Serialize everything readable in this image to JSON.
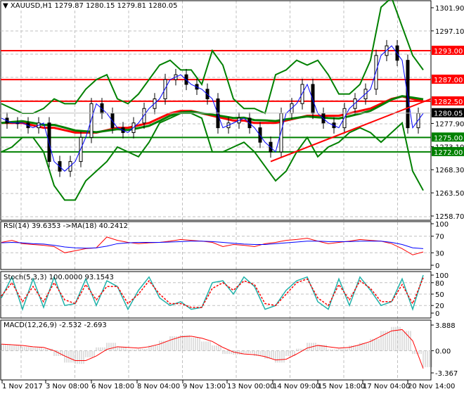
{
  "header": {
    "symbol": "XAUUSD,H1",
    "ohlc": "1279.87 1280.15 1279.81 1280.05"
  },
  "colors": {
    "up_line": "#ff0000",
    "support": "#008000",
    "bands": "#008000",
    "price": "#000000",
    "rsi": "#ff0000",
    "rsi_ma": "#0000ff",
    "stoch_k": "#20b2aa",
    "stoch_d": "#ff0000",
    "macd": "#c0c0c0",
    "signal": "#ff0000",
    "current": "#000000"
  },
  "chart_data": [
    {
      "type": "line",
      "title": "XAUUSD,H1",
      "ylim": [
        1258.7,
        1301.9
      ],
      "y_ticks": [
        "1301.90",
        "1297.10",
        "1293.00",
        "1287.00",
        "1282.50",
        "1280.05",
        "1277.90",
        "1275.00",
        "1273.10",
        "1272.00",
        "1268.30",
        "1263.50",
        "1258.70"
      ],
      "x_ticks": [
        "1 Nov 2017",
        "3 Nov 08:00",
        "6 Nov 18:00",
        "8 Nov 04:00",
        "9 Nov 13:00",
        "13 Nov 00:00",
        "14 Nov 09:00",
        "15 Nov 18:00",
        "17 Nov 04:00",
        "20 Nov 14:00"
      ],
      "resistance_levels": [
        1293.0,
        1287.0,
        1282.5
      ],
      "support_levels": [
        1275.0,
        1272.0
      ],
      "current_price": 1280.05,
      "trendline": [
        [
          1270.0,
          1283.0
        ]
      ],
      "series": [
        {
          "key": "close",
          "values": [
            1279,
            1278,
            1278,
            1277,
            1278,
            1270,
            1268,
            1270,
            1275,
            1282,
            1280,
            1277,
            1276,
            1278,
            1281,
            1283,
            1287,
            1288,
            1286,
            1285,
            1283,
            1277,
            1278,
            1279,
            1277,
            1274,
            1272,
            1280,
            1282,
            1286,
            1280,
            1278,
            1277,
            1281,
            1283,
            1285,
            1292,
            1294,
            1291,
            1277,
            1280
          ]
        },
        {
          "key": "upper_band",
          "values": [
            1282,
            1281,
            1280,
            1280,
            1281,
            1283,
            1282,
            1282,
            1285,
            1287,
            1288,
            1283,
            1282,
            1284,
            1287,
            1290,
            1291,
            1289,
            1289,
            1286,
            1293,
            1290,
            1283,
            1281,
            1281,
            1280,
            1288,
            1289,
            1291,
            1290,
            1291,
            1288,
            1284,
            1284,
            1286,
            1291,
            1302,
            1304,
            1298,
            1292,
            1289
          ]
        },
        {
          "key": "lower_band",
          "values": [
            1272,
            1273,
            1275,
            1275,
            1272,
            1265,
            1262,
            1262,
            1266,
            1268,
            1270,
            1273,
            1272,
            1271,
            1274,
            1278,
            1279,
            1280,
            1280,
            1279,
            1272,
            1272,
            1273,
            1274,
            1272,
            1269,
            1266,
            1268,
            1272,
            1275,
            1271,
            1273,
            1274,
            1276,
            1277,
            1276,
            1274,
            1276,
            1278,
            1268,
            1264
          ]
        },
        {
          "key": "slow_ma",
          "values": [
            1278,
            1278,
            1278,
            1277.5,
            1277,
            1277,
            1276.5,
            1276,
            1276,
            1276,
            1276.5,
            1277,
            1277,
            1277.5,
            1278,
            1279,
            1280,
            1280.5,
            1280.5,
            1280,
            1279.5,
            1279,
            1278.5,
            1278.5,
            1278,
            1278,
            1278,
            1278.5,
            1279,
            1279.5,
            1279.5,
            1279.5,
            1279.5,
            1280,
            1280.5,
            1281,
            1282,
            1283,
            1283.5,
            1283,
            1282.5
          ]
        }
      ]
    },
    {
      "type": "line",
      "title": "RSI(14) 39.6353  ->MA(18) 40.2412",
      "ylim": [
        0,
        100
      ],
      "y_ticks": [
        "100",
        "70",
        "30",
        "0"
      ],
      "series": [
        {
          "key": "rsi",
          "values": [
            55,
            60,
            52,
            50,
            48,
            45,
            30,
            35,
            40,
            42,
            68,
            60,
            55,
            52,
            54,
            55,
            58,
            62,
            60,
            58,
            55,
            45,
            50,
            48,
            45,
            52,
            55,
            60,
            62,
            65,
            58,
            52,
            55,
            58,
            62,
            60,
            58,
            52,
            40,
            25,
            32
          ]
        },
        {
          "key": "rsi_ma",
          "values": [
            54,
            55,
            54,
            52,
            51,
            48,
            44,
            42,
            41,
            42,
            46,
            52,
            54,
            55,
            55,
            55,
            56,
            57,
            58,
            58,
            57,
            55,
            53,
            51,
            50,
            50,
            52,
            54,
            56,
            58,
            58,
            57,
            57,
            57,
            58,
            58,
            58,
            55,
            50,
            42,
            40
          ]
        }
      ]
    },
    {
      "type": "line",
      "title": "Stoch(5,3,3) 100.0000 93.1543",
      "ylim": [
        0,
        100
      ],
      "y_ticks": [
        "100",
        "80",
        "50",
        "20",
        "0"
      ],
      "series": [
        {
          "key": "k",
          "values": [
            40,
            95,
            10,
            90,
            15,
            95,
            20,
            25,
            90,
            20,
            85,
            70,
            10,
            60,
            95,
            40,
            20,
            30,
            10,
            15,
            80,
            85,
            50,
            95,
            70,
            10,
            20,
            60,
            85,
            95,
            30,
            10,
            90,
            20,
            95,
            60,
            20,
            30,
            90,
            10,
            100
          ]
        },
        {
          "key": "d",
          "values": [
            45,
            80,
            30,
            70,
            30,
            80,
            35,
            25,
            75,
            35,
            70,
            70,
            25,
            50,
            85,
            50,
            25,
            25,
            15,
            15,
            65,
            80,
            60,
            85,
            75,
            25,
            20,
            50,
            80,
            90,
            40,
            20,
            75,
            35,
            85,
            65,
            30,
            30,
            75,
            25,
            93
          ]
        }
      ]
    },
    {
      "type": "bar",
      "title": "MACD(12,26,9) -2.532 -2.693",
      "ylim": [
        -3.367,
        3.888
      ],
      "y_ticks": [
        "3.888",
        "0.00",
        "-3.367"
      ],
      "series": [
        {
          "key": "macd",
          "values": [
            1.0,
            0.8,
            0.6,
            0.5,
            0.3,
            -0.8,
            -1.8,
            -2.0,
            -1.0,
            0.5,
            1.2,
            0.6,
            0.2,
            0.3,
            0.8,
            1.5,
            2.2,
            2.4,
            2.0,
            1.4,
            0.8,
            -0.5,
            -0.6,
            -0.4,
            -0.8,
            -1.2,
            -1.8,
            -0.8,
            0.3,
            1.2,
            0.9,
            0.2,
            0.3,
            0.8,
            1.2,
            1.8,
            3.0,
            3.6,
            3.0,
            -0.5,
            -2.5
          ]
        },
        {
          "key": "signal",
          "values": [
            1.0,
            0.9,
            0.8,
            0.6,
            0.5,
            0.0,
            -0.8,
            -1.5,
            -1.5,
            -0.8,
            0.2,
            0.6,
            0.5,
            0.4,
            0.6,
            1.0,
            1.6,
            2.1,
            2.2,
            1.9,
            1.4,
            0.5,
            -0.2,
            -0.5,
            -0.6,
            -0.9,
            -1.4,
            -1.3,
            -0.5,
            0.4,
            0.8,
            0.6,
            0.4,
            0.5,
            0.9,
            1.4,
            2.2,
            3.0,
            3.2,
            1.5,
            -2.7
          ]
        }
      ]
    }
  ]
}
